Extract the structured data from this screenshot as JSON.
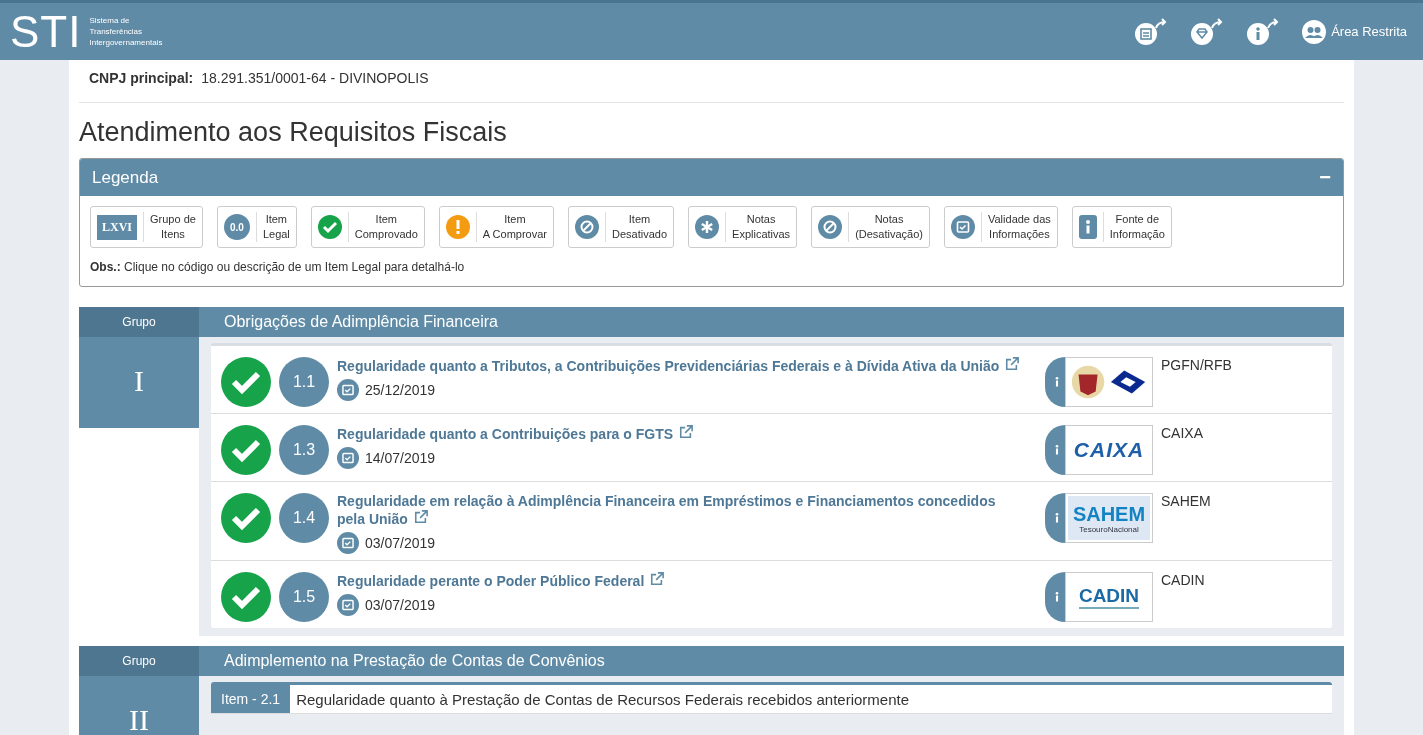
{
  "header": {
    "logo": "STI",
    "subtitle": [
      "Sistema de",
      "Transferências",
      "Intergovernamentais"
    ],
    "restricted": "Área Restrita"
  },
  "cnpj": {
    "label": "CNPJ principal:",
    "value": "18.291.351/0001-64 - DIVINOPOLIS"
  },
  "title": "Atendimento aos Requisitos Fiscais",
  "legend": {
    "title": "Legenda",
    "collapse": "−",
    "items": [
      {
        "kind": "roman",
        "mark": "LXVI",
        "label": [
          "Grupo de",
          "Itens"
        ]
      },
      {
        "kind": "code",
        "mark": "0.0",
        "label": [
          "Item",
          "Legal"
        ]
      },
      {
        "kind": "check",
        "label": [
          "Item",
          "Comprovado"
        ]
      },
      {
        "kind": "warn",
        "label": [
          "Item",
          "A Comprovar"
        ]
      },
      {
        "kind": "off",
        "label": [
          "Item",
          "Desativado"
        ]
      },
      {
        "kind": "star",
        "label": [
          "Notas",
          "Explicativas"
        ]
      },
      {
        "kind": "off",
        "label": [
          "Notas",
          "(Desativação)"
        ]
      },
      {
        "kind": "calendar",
        "label": [
          "Validade das",
          "Informações"
        ]
      },
      {
        "kind": "info",
        "label": [
          "Fonte de",
          "Informação"
        ]
      }
    ],
    "obs_label": "Obs.:",
    "obs": "Clique no código ou descrição de um Item Legal para detalhá-lo"
  },
  "groups": [
    {
      "label": "Grupo",
      "numeral": "I",
      "title": "Obrigações de Adimplência Financeira",
      "items": [
        {
          "kind": "check",
          "code": "1.1",
          "title": "Regularidade quanto a Tributos, a Contribuições Previdenciárias Federais e à Dívida Ativa da União",
          "date": "25/12/2019",
          "logo": {
            "kind": "seal"
          },
          "source": "PGFN/RFB"
        },
        {
          "kind": "check",
          "code": "1.3",
          "title": "Regularidade quanto a Contribuições para o FGTS",
          "date": "14/07/2019",
          "logo": {
            "kind": "italic",
            "text": "CAIXA"
          },
          "source": "CAIXA"
        },
        {
          "kind": "check",
          "code": "1.4",
          "title": "Regularidade em relação à Adimplência Financeira em Empréstimos e Financiamentos concedidos pela União",
          "date": "03/07/2019",
          "logo": {
            "kind": "banner",
            "text": "SAHEM",
            "sub": "TesouroNacional"
          },
          "source": "SAHEM"
        },
        {
          "kind": "check",
          "code": "1.5",
          "title": "Regularidade perante o Poder Público Federal",
          "date": "03/07/2019",
          "logo": {
            "kind": "underlined",
            "text": "CADIN"
          },
          "source": "CADIN"
        }
      ]
    },
    {
      "label": "Grupo",
      "numeral": "II",
      "title": "Adimplemento na Prestação de Contas de Convênios",
      "subheader": {
        "code": "Item - 2.1",
        "text": "Regularidade quanto à Prestação de Contas de Recursos Federais recebidos anteriormente"
      }
    }
  ]
}
